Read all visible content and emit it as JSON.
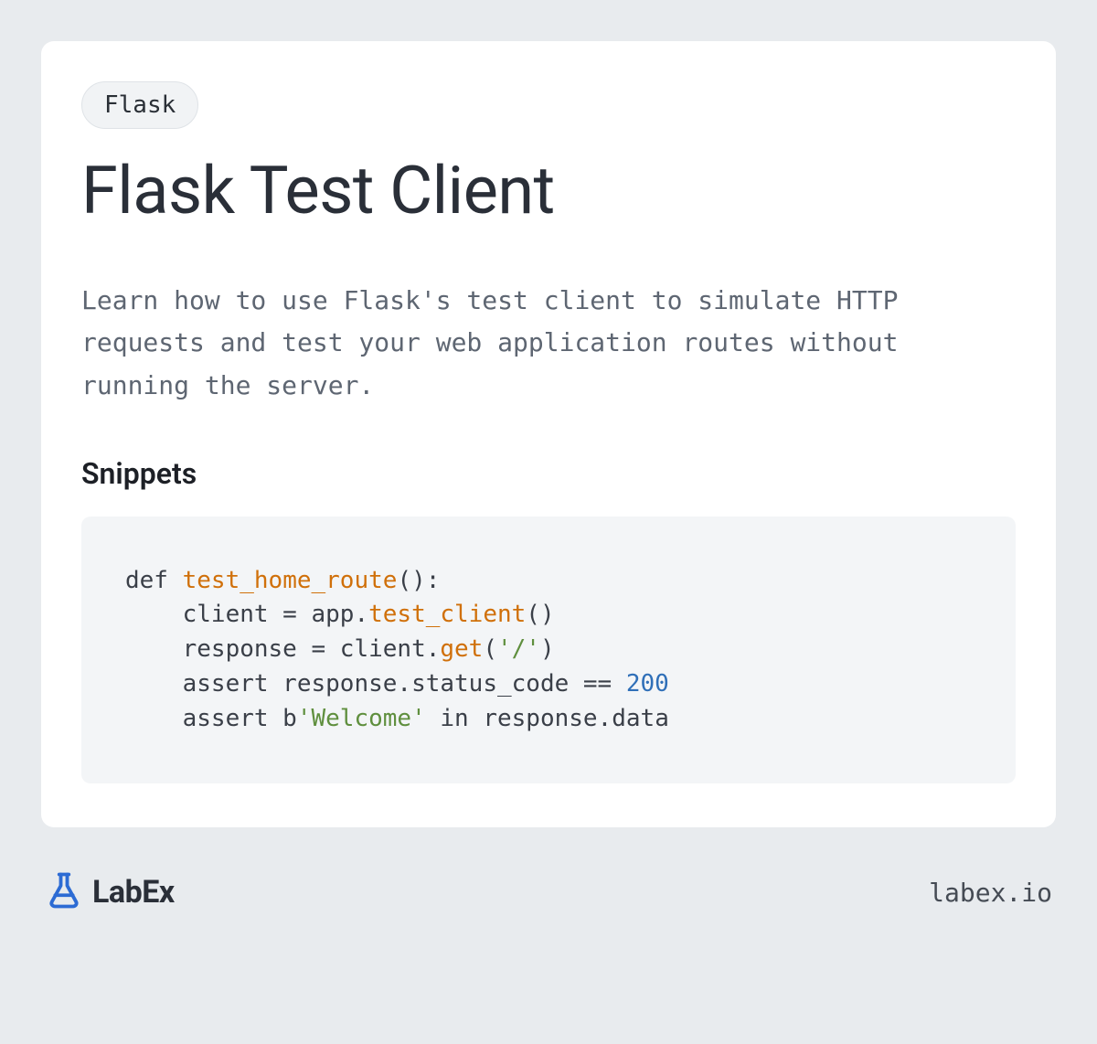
{
  "tag": "Flask",
  "title": "Flask Test Client",
  "description": "Learn how to use Flask's test client to simulate HTTP requests and test your web application routes without running the server.",
  "section_heading": "Snippets",
  "code": {
    "line1_a": "def ",
    "line1_fn": "test_home_route",
    "line1_b": "():",
    "line2_a": "    client = app.",
    "line2_fn": "test_client",
    "line2_b": "()",
    "line3_a": "    response = client.",
    "line3_fn": "get",
    "line3_b": "(",
    "line3_str": "'/'",
    "line3_c": ")",
    "line4_a": "    assert response.status_code == ",
    "line4_num": "200",
    "line5_a": "    assert b",
    "line5_str": "'Welcome'",
    "line5_b": " in response.data"
  },
  "footer": {
    "brand": "LabEx",
    "url": "labex.io"
  }
}
